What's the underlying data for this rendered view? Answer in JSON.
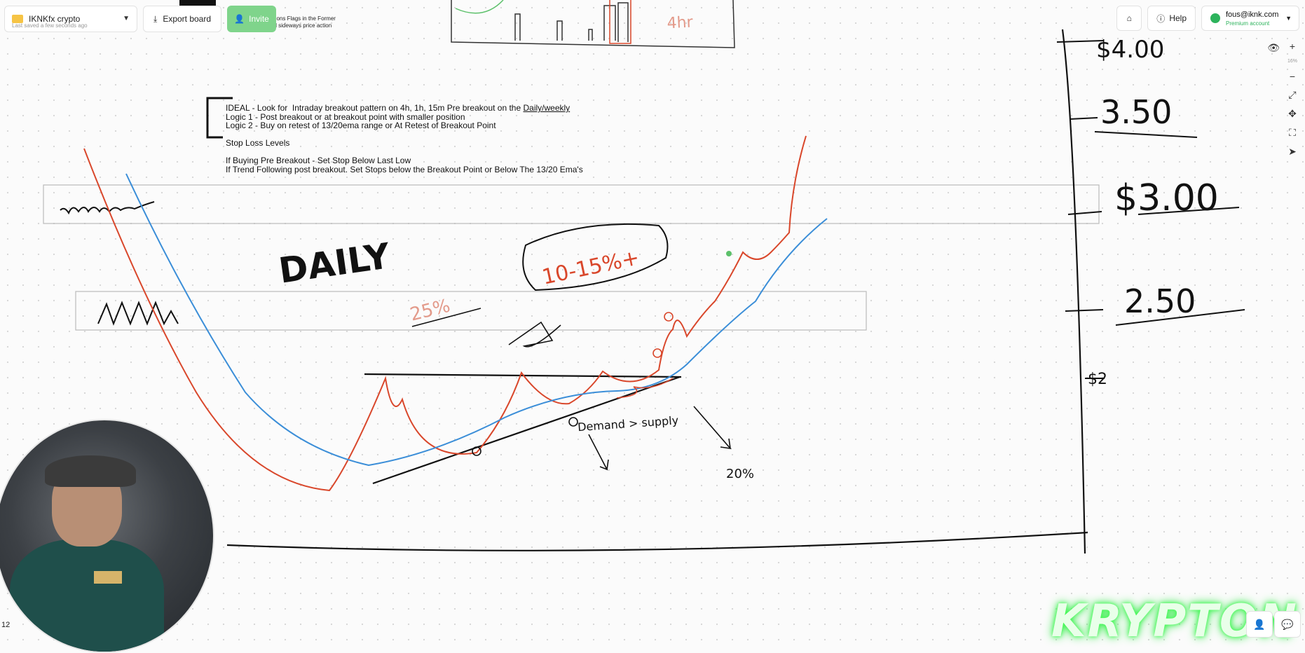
{
  "toolbar": {
    "board_name": "IKNKfx crypto",
    "saved_status": "Last saved a few seconds ago",
    "export_label": "Export board",
    "invite_label": "Invite",
    "help_label": "Help",
    "user_email": "fous@iknk.com",
    "user_plan": "Premium account",
    "zoom_percent": "16%"
  },
  "top_note": {
    "line1": "vious Consolidations Flags in the Former",
    "line2": "avier volume and sideways price action"
  },
  "notes": {
    "ideal_prefix": "IDEAL - Look for  Intraday breakout pattern on 4h, 1h, 15m Pre breakout on the ",
    "ideal_underlined": "Daily/weekly",
    "logic1": "Logic 1 - Post breakout or at breakout point with smaller position",
    "logic2": "Logic 2 - Buy on retest of 13/20ema range or At Retest of Breakout Point",
    "stop_heading": "Stop Loss Levels",
    "stop_pre": "If Buying Pre Breakout - Set Stop Below Last Low",
    "stop_trend": "If Trend Following post breakout. Set Stops below the Breakout Point or Below The 13/20 Ema's"
  },
  "handwriting": {
    "daily": "DAILY",
    "target_pct": "10-15%+",
    "pct_25": "25%",
    "pct_20": "20%",
    "demand_supply": "Demand > supply",
    "price_4": "$4.00",
    "price_350": "3.50",
    "price_3": "$3.00",
    "price_250": "2.50",
    "price_2": "$2",
    "box_label": "4hr"
  },
  "overlay": {
    "brand": "KRYPTON",
    "counter": "12"
  },
  "colors": {
    "invite_green": "#7fd48b",
    "account_green": "#2db35c",
    "price_red": "#d9472b",
    "ema_blue": "#3b8ed8",
    "krypton_glow": "#3cff4e"
  }
}
